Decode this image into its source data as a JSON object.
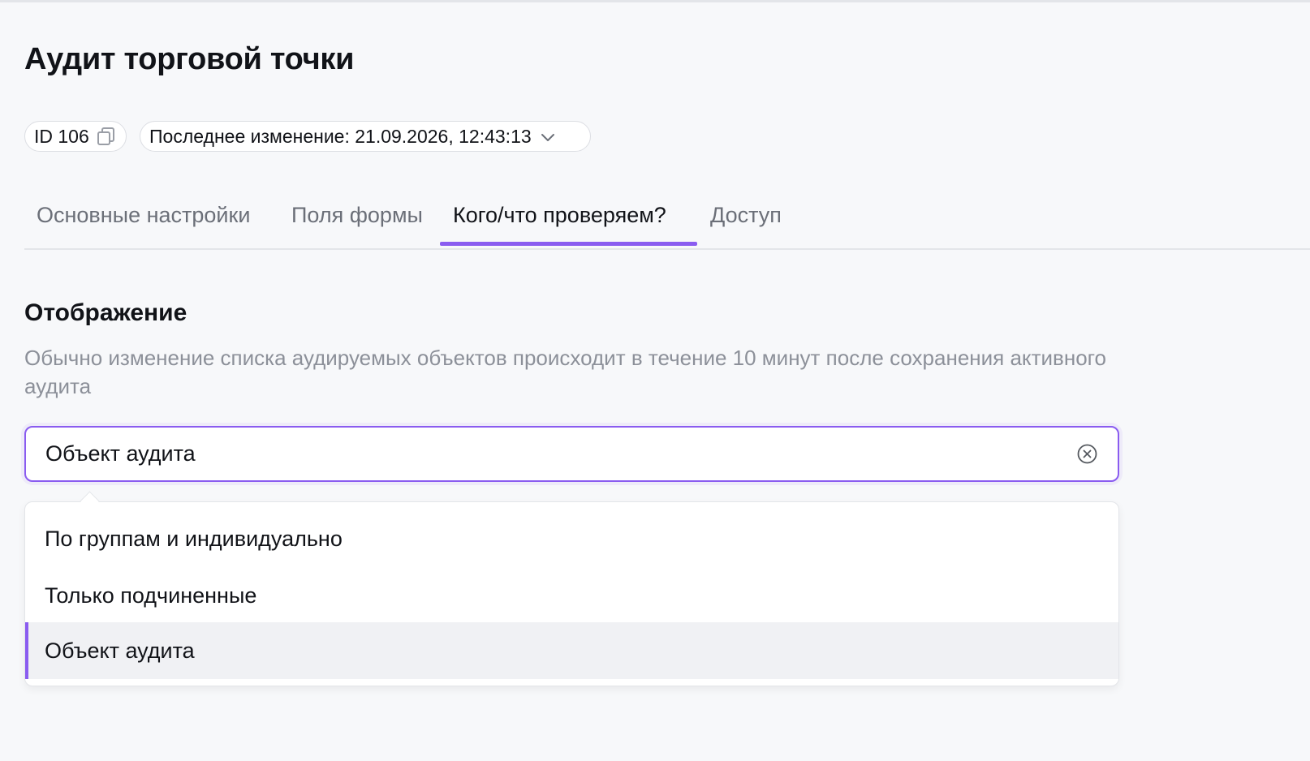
{
  "page": {
    "title": "Аудит торговой точки"
  },
  "meta": {
    "id_label": "ID 106",
    "last_modified_label": "Последнее изменение: 21.09.2026, 12:43:13"
  },
  "tabs": [
    {
      "label": "Основные настройки",
      "active": false
    },
    {
      "label": "Поля формы",
      "active": false
    },
    {
      "label": "Кого/что проверяем?",
      "active": true
    },
    {
      "label": "Доступ",
      "active": false
    }
  ],
  "section": {
    "title": "Отображение",
    "description": "Обычно изменение списка аудируемых объектов происходит в течение 10 минут после сохранения активного аудита"
  },
  "select": {
    "value": "Объект аудита",
    "options": [
      {
        "label": "По группам и индивидуально",
        "selected": false
      },
      {
        "label": "Только подчиненные",
        "selected": false
      },
      {
        "label": "Объект аудита",
        "selected": true
      }
    ]
  },
  "colors": {
    "accent": "#8a5cf0",
    "background": "#f7f8fa",
    "muted_text": "#8c9099",
    "tab_inactive": "#6b6f78",
    "selected_option_bg": "#f0f1f4"
  },
  "icons": {
    "copy": "copy-icon",
    "chevron": "chevron-down-icon",
    "clear": "clear-circle-icon"
  }
}
